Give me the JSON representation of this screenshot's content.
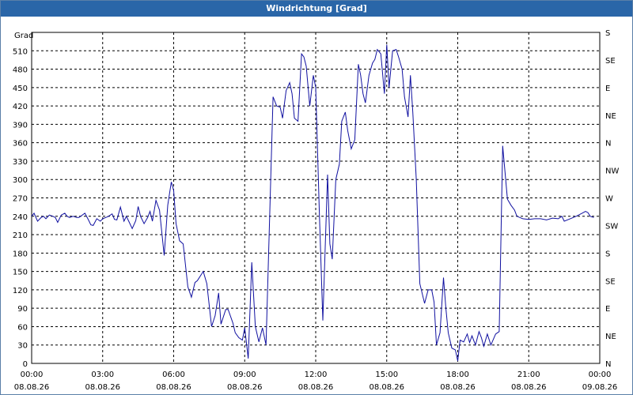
{
  "title": "Windrichtung [Grad]",
  "colors": {
    "title_bar": "#2a66a8",
    "line": "#1010a0",
    "grid": "#000000"
  },
  "chart_data": {
    "type": "line",
    "title": "Windrichtung [Grad]",
    "ylabel": "Grad",
    "ylim": [
      0,
      540
    ],
    "y_ticks": [
      0,
      30,
      60,
      90,
      120,
      150,
      180,
      210,
      240,
      270,
      300,
      330,
      360,
      390,
      420,
      450,
      480,
      510
    ],
    "y_ticks_right": [
      "N",
      "NE",
      "E",
      "SE",
      "S",
      "SW",
      "W",
      "NW",
      "N",
      "NE",
      "E",
      "SE",
      "S"
    ],
    "x_ticks": [
      {
        "time": "00:00",
        "date": "08.08.26"
      },
      {
        "time": "03:00",
        "date": "08.08.26"
      },
      {
        "time": "06:00",
        "date": "08.08.26"
      },
      {
        "time": "09:00",
        "date": "08.08.26"
      },
      {
        "time": "12:00",
        "date": "08.08.26"
      },
      {
        "time": "15:00",
        "date": "08.08.26"
      },
      {
        "time": "18:00",
        "date": "08.08.26"
      },
      {
        "time": "21:00",
        "date": "08.08.26"
      },
      {
        "time": "00:00",
        "date": "09.08.26"
      }
    ],
    "xlim_hours": [
      0,
      24
    ],
    "grid": true,
    "series": [
      {
        "points": [
          [
            0.0,
            240
          ],
          [
            0.1,
            245
          ],
          [
            0.25,
            232
          ],
          [
            0.4,
            238
          ],
          [
            0.5,
            240
          ],
          [
            0.6,
            236
          ],
          [
            0.75,
            242
          ],
          [
            0.9,
            240
          ],
          [
            1.0,
            238
          ],
          [
            1.1,
            230
          ],
          [
            1.25,
            242
          ],
          [
            1.4,
            245
          ],
          [
            1.5,
            240
          ],
          [
            1.6,
            238
          ],
          [
            1.75,
            240
          ],
          [
            1.9,
            238
          ],
          [
            2.0,
            238
          ],
          [
            2.25,
            245
          ],
          [
            2.4,
            234
          ],
          [
            2.5,
            226
          ],
          [
            2.6,
            225
          ],
          [
            2.75,
            236
          ],
          [
            2.9,
            232
          ],
          [
            3.0,
            236
          ],
          [
            3.25,
            240
          ],
          [
            3.4,
            244
          ],
          [
            3.5,
            235
          ],
          [
            3.6,
            234
          ],
          [
            3.75,
            255
          ],
          [
            3.9,
            232
          ],
          [
            4.0,
            240
          ],
          [
            4.1,
            232
          ],
          [
            4.25,
            220
          ],
          [
            4.4,
            233
          ],
          [
            4.5,
            256
          ],
          [
            4.6,
            240
          ],
          [
            4.75,
            228
          ],
          [
            4.9,
            238
          ],
          [
            5.0,
            248
          ],
          [
            5.1,
            232
          ],
          [
            5.25,
            266
          ],
          [
            5.4,
            250
          ],
          [
            5.6,
            176
          ],
          [
            5.75,
            258
          ],
          [
            5.9,
            296
          ],
          [
            6.0,
            282
          ],
          [
            6.1,
            228
          ],
          [
            6.25,
            200
          ],
          [
            6.4,
            195
          ],
          [
            6.6,
            125
          ],
          [
            6.75,
            108
          ],
          [
            6.9,
            132
          ],
          [
            7.0,
            135
          ],
          [
            7.25,
            150
          ],
          [
            7.4,
            130
          ],
          [
            7.6,
            60
          ],
          [
            7.75,
            78
          ],
          [
            7.9,
            115
          ],
          [
            8.0,
            64
          ],
          [
            8.2,
            88
          ],
          [
            8.3,
            88
          ],
          [
            8.5,
            66
          ],
          [
            8.6,
            50
          ],
          [
            8.75,
            42
          ],
          [
            8.9,
            38
          ],
          [
            9.0,
            58
          ],
          [
            9.15,
            8
          ],
          [
            9.3,
            165
          ],
          [
            9.45,
            60
          ],
          [
            9.6,
            35
          ],
          [
            9.75,
            58
          ],
          [
            9.9,
            30
          ],
          [
            10.2,
            435
          ],
          [
            10.35,
            420
          ],
          [
            10.5,
            418
          ],
          [
            10.6,
            400
          ],
          [
            10.75,
            445
          ],
          [
            10.9,
            458
          ],
          [
            11.0,
            440
          ],
          [
            11.1,
            400
          ],
          [
            11.25,
            395
          ],
          [
            11.4,
            505
          ],
          [
            11.5,
            500
          ],
          [
            11.6,
            485
          ],
          [
            11.75,
            420
          ],
          [
            11.9,
            470
          ],
          [
            12.0,
            450
          ],
          [
            12.15,
            250
          ],
          [
            12.3,
            70
          ],
          [
            12.5,
            308
          ],
          [
            12.6,
            195
          ],
          [
            12.7,
            170
          ],
          [
            12.85,
            300
          ],
          [
            13.0,
            325
          ],
          [
            13.1,
            395
          ],
          [
            13.25,
            410
          ],
          [
            13.35,
            380
          ],
          [
            13.5,
            350
          ],
          [
            13.65,
            365
          ],
          [
            13.8,
            488
          ],
          [
            13.9,
            470
          ],
          [
            14.0,
            440
          ],
          [
            14.1,
            425
          ],
          [
            14.25,
            470
          ],
          [
            14.4,
            490
          ],
          [
            14.5,
            496
          ],
          [
            14.6,
            512
          ],
          [
            14.75,
            505
          ],
          [
            14.9,
            440
          ],
          [
            15.0,
            520
          ],
          [
            15.1,
            450
          ],
          [
            15.25,
            510
          ],
          [
            15.4,
            512
          ],
          [
            15.5,
            500
          ],
          [
            15.65,
            480
          ],
          [
            15.75,
            435
          ],
          [
            15.9,
            402
          ],
          [
            16.0,
            470
          ],
          [
            16.1,
            410
          ],
          [
            16.25,
            300
          ],
          [
            16.4,
            130
          ],
          [
            16.6,
            98
          ],
          [
            16.75,
            120
          ],
          [
            16.9,
            120
          ],
          [
            17.0,
            100
          ],
          [
            17.1,
            30
          ],
          [
            17.25,
            50
          ],
          [
            17.4,
            140
          ],
          [
            17.5,
            90
          ],
          [
            17.6,
            50
          ],
          [
            17.75,
            25
          ],
          [
            17.9,
            22
          ],
          [
            18.0,
            4
          ],
          [
            18.1,
            38
          ],
          [
            18.25,
            35
          ],
          [
            18.4,
            48
          ],
          [
            18.5,
            34
          ],
          [
            18.6,
            45
          ],
          [
            18.75,
            30
          ],
          [
            18.9,
            52
          ],
          [
            19.0,
            42
          ],
          [
            19.1,
            28
          ],
          [
            19.25,
            48
          ],
          [
            19.4,
            30
          ],
          [
            19.6,
            48
          ],
          [
            19.75,
            52
          ],
          [
            19.9,
            355
          ],
          [
            20.1,
            268
          ],
          [
            20.25,
            258
          ],
          [
            20.4,
            250
          ],
          [
            20.5,
            240
          ],
          [
            20.75,
            236
          ],
          [
            21.0,
            235
          ],
          [
            21.25,
            236
          ],
          [
            21.5,
            236
          ],
          [
            21.75,
            234
          ],
          [
            22.0,
            237
          ],
          [
            22.25,
            236
          ],
          [
            22.4,
            240
          ],
          [
            22.5,
            232
          ],
          [
            22.75,
            236
          ],
          [
            23.0,
            240
          ],
          [
            23.25,
            245
          ],
          [
            23.4,
            248
          ],
          [
            23.5,
            246
          ],
          [
            23.6,
            240
          ],
          [
            23.75,
            238
          ]
        ]
      }
    ]
  }
}
